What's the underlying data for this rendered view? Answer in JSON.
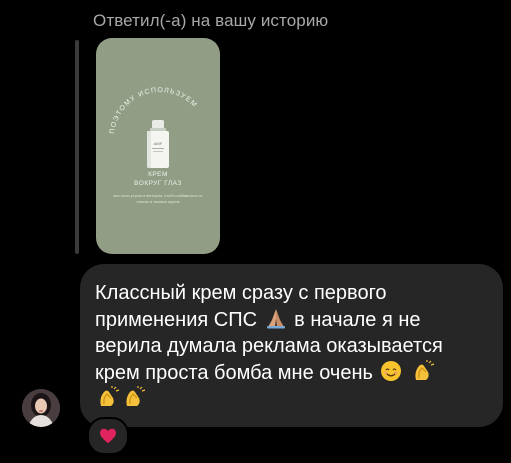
{
  "reply": {
    "label": "Ответил(-а) на вашу историю"
  },
  "story": {
    "arc_text": "ПОЭТОМУ ИСПОЛЬЗУЕМ",
    "brand": "AMF",
    "title_line1": "КРЕМ",
    "title_line2": "ВОКРУГ ГЛАЗ",
    "small_text": "все если утром и вечером, чтобы избавиться от отеков и темных кругов",
    "bg_color": "#929d86"
  },
  "message": {
    "line1": "Классный крем сразу с первого",
    "line2a": "применения СПС",
    "line2b": "в начале я не",
    "line3": "верила думала реклама оказывается",
    "line4": "крем проста бомба мне очень",
    "bubble_color": "#262626"
  },
  "reaction": {
    "icon": "heart-icon",
    "color": "#e0245e"
  },
  "avatar": {
    "icon": "avatar"
  }
}
